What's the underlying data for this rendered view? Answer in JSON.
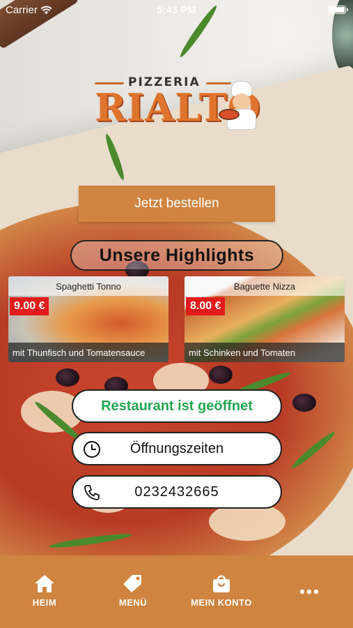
{
  "status_bar": {
    "carrier": "Carrier",
    "time": "5:43 PM"
  },
  "logo": {
    "top_text": "PIZZERIA",
    "main_text": "RIALTO"
  },
  "order_button": "Jetzt bestellen",
  "highlights_title": "Unsere Highlights",
  "products": [
    {
      "name": "Spaghetti Tonno",
      "price": "9.00 €",
      "description": "mit Thunfisch und Tomatensauce"
    },
    {
      "name": "Baguette Nizza",
      "price": "8.00 €",
      "description": "mit Schinken und Tomaten"
    }
  ],
  "info": {
    "status": "Restaurant ist geöffnet",
    "opening_hours": "Öffnungszeiten",
    "phone": "0232432665"
  },
  "tab_bar": {
    "items": [
      {
        "label": "HEIM",
        "icon": "home-icon"
      },
      {
        "label": "MENÜ",
        "icon": "tag-icon"
      },
      {
        "label": "MEIN KONTO",
        "icon": "shopping-bag-icon"
      },
      {
        "label": "",
        "icon": "more-icon"
      }
    ]
  },
  "colors": {
    "accent": "#cf8440",
    "price_badge": "#e41b1b",
    "open_status": "#24a650",
    "logo_orange": "#e0742c"
  }
}
